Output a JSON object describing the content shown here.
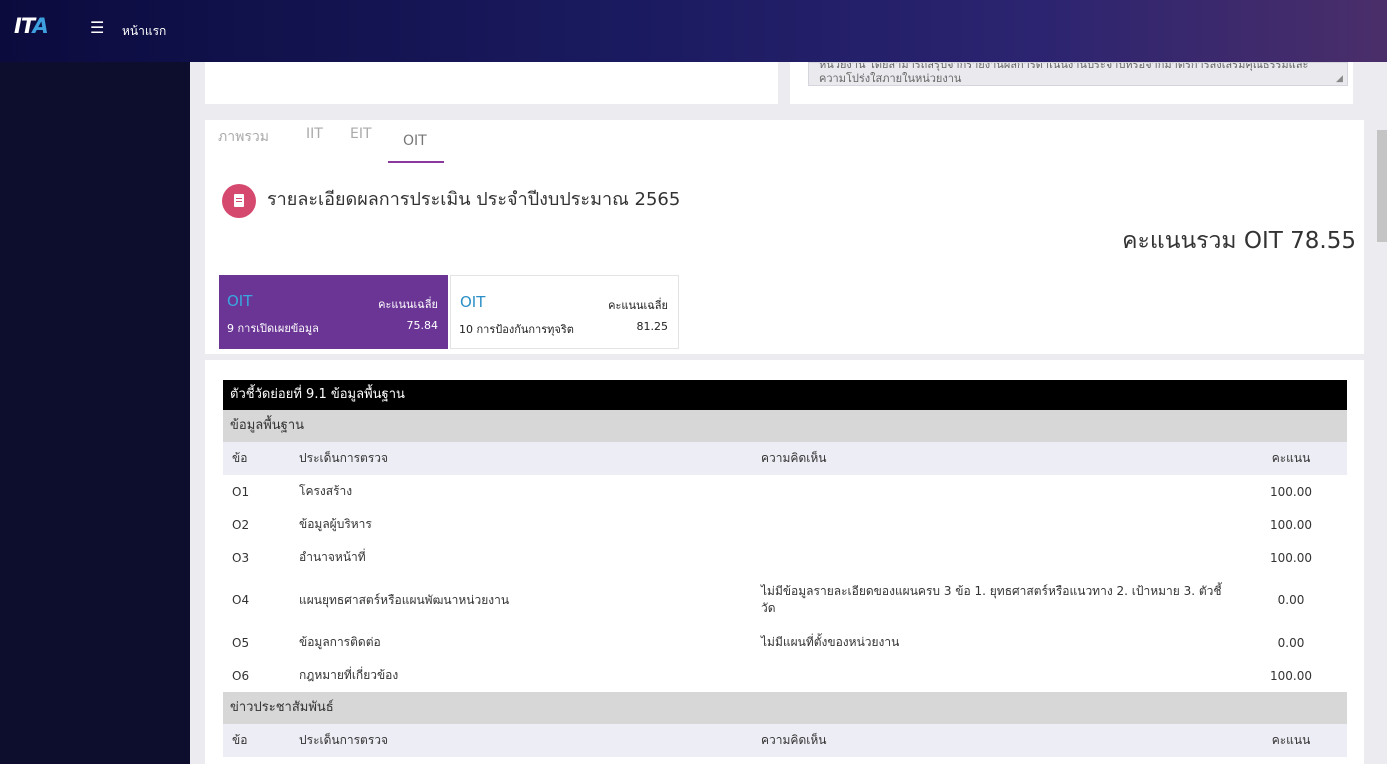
{
  "header": {
    "logo_main": "IT",
    "logo_accent": "A",
    "menu_icon": "hamburger-icon",
    "home": "หน้าแรก"
  },
  "top_textarea": {
    "line1": "หน่วยงาน โดยสามารถสรุปจากรายงานผลการดำเนินงานประจำปีหรือจากมาตรการส่งเสริมคุณธรรมและ",
    "line2": "ความโปร่งใสภายในหน่วยงาน"
  },
  "tabs": [
    "ภาพรวม",
    "IIT",
    "EIT",
    "OIT"
  ],
  "active_tab": "OIT",
  "report": {
    "icon": "document-icon",
    "title": "รายละเอียดผลการประเมิน ประจำปีงบประมาณ 2565"
  },
  "total_score": "คะแนนรวม OIT 78.55",
  "indicators": [
    {
      "name": "OIT",
      "avg_label": "คะแนนเฉลี่ย",
      "desc": "9 การเปิดเผยข้อมูล",
      "score": "75.84"
    },
    {
      "name": "OIT",
      "avg_label": "คะแนนเฉลี่ย",
      "desc": "10 การป้องกันการทุจริต",
      "score": "81.25"
    }
  ],
  "table": {
    "title": "ตัวชี้วัดย่อยที่ 9.1 ข้อมูลพื้นฐาน",
    "columns": {
      "no": "ข้อ",
      "issue": "ประเด็นการตรวจ",
      "comment": "ความคิดเห็น",
      "score": "คะแนน"
    },
    "sections": [
      {
        "name": "ข้อมูลพื้นฐาน",
        "rows": [
          {
            "no": "O1",
            "issue": "โครงสร้าง",
            "comment": "",
            "score": "100.00"
          },
          {
            "no": "O2",
            "issue": "ข้อมูลผู้บริหาร",
            "comment": "",
            "score": "100.00"
          },
          {
            "no": "O3",
            "issue": "อำนาจหน้าที่",
            "comment": "",
            "score": "100.00"
          },
          {
            "no": "O4",
            "issue": "แผนยุทธศาสตร์หรือแผนพัฒนาหน่วยงาน",
            "comment": "ไม่มีข้อมูลรายละเอียดของแผนครบ 3 ข้อ 1. ยุทธศาสตร์หรือแนวทาง 2. เป้าหมาย 3. ตัวชี้วัด",
            "score": "0.00"
          },
          {
            "no": "O5",
            "issue": "ข้อมูลการติดต่อ",
            "comment": "ไม่มีแผนที่ตั้งของหน่วยงาน",
            "score": "0.00"
          },
          {
            "no": "O6",
            "issue": "กฎหมายที่เกี่ยวข้อง",
            "comment": "",
            "score": "100.00"
          }
        ]
      },
      {
        "name": "ข่าวประชาสัมพันธ์",
        "rows": []
      }
    ]
  }
}
